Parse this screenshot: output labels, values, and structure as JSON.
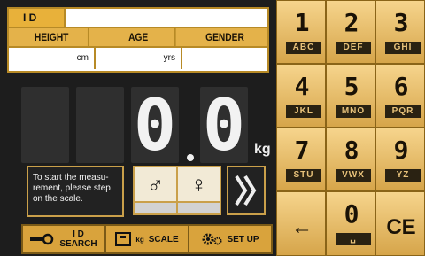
{
  "info": {
    "id_label": "I D",
    "id_value": "",
    "headers": [
      "HEIGHT",
      "AGE",
      "GENDER"
    ],
    "values": [
      ". cm",
      "yrs",
      ""
    ]
  },
  "display": {
    "digits": [
      "",
      "",
      "0",
      "0"
    ],
    "unit": "kg"
  },
  "message": "To start the measu-rement, please step on the scale.",
  "gender": {
    "male_symbol": "♂",
    "female_symbol": "♀"
  },
  "next_symbol": "»",
  "toolbar": {
    "id_search_line1": "I D",
    "id_search_line2": "SEARCH",
    "scale_unit": "kg",
    "scale_label": "SCALE",
    "setup_label": "SET UP"
  },
  "keypad": {
    "keys": [
      {
        "num": "1",
        "letters": "ABC"
      },
      {
        "num": "2",
        "letters": "DEF"
      },
      {
        "num": "3",
        "letters": "GHI"
      },
      {
        "num": "4",
        "letters": "JKL"
      },
      {
        "num": "5",
        "letters": "MNO"
      },
      {
        "num": "6",
        "letters": "PQR"
      },
      {
        "num": "7",
        "letters": "STU"
      },
      {
        "num": "8",
        "letters": "VWX"
      },
      {
        "num": "9",
        "letters": "YZ"
      }
    ],
    "back_symbol": "←",
    "zero": "0",
    "clear_label": "CE"
  },
  "colors": {
    "accent": "#e4b24a",
    "keypad_bg": "#b68b2d",
    "panel_bg": "#1d1d1d"
  }
}
